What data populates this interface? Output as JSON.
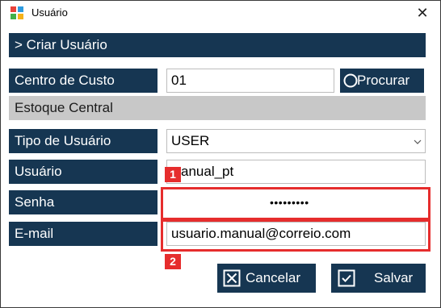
{
  "window": {
    "title": "Usuário",
    "close_glyph": "✕"
  },
  "header": {
    "title": "> Criar Usuário"
  },
  "form": {
    "centro_label": "Centro de Custo",
    "centro_value": "01",
    "procurar_label": "Procurar",
    "estoque_label": "Estoque Central",
    "tipo_label": "Tipo de Usuário",
    "tipo_value": "USER",
    "usuario_label": "Usuário",
    "usuario_value": "anual_pt",
    "senha_label": "Senha",
    "senha_value": "•••••••••",
    "email_label": "E-mail",
    "email_value": "usuario.manual@correio.com"
  },
  "annotations": {
    "badge1": "1",
    "badge2": "2",
    "color": "#e62d2d"
  },
  "buttons": {
    "cancel_label": "Cancelar",
    "save_label": "Salvar"
  },
  "colors": {
    "accent": "#163652",
    "section": "#c8c8c8"
  }
}
